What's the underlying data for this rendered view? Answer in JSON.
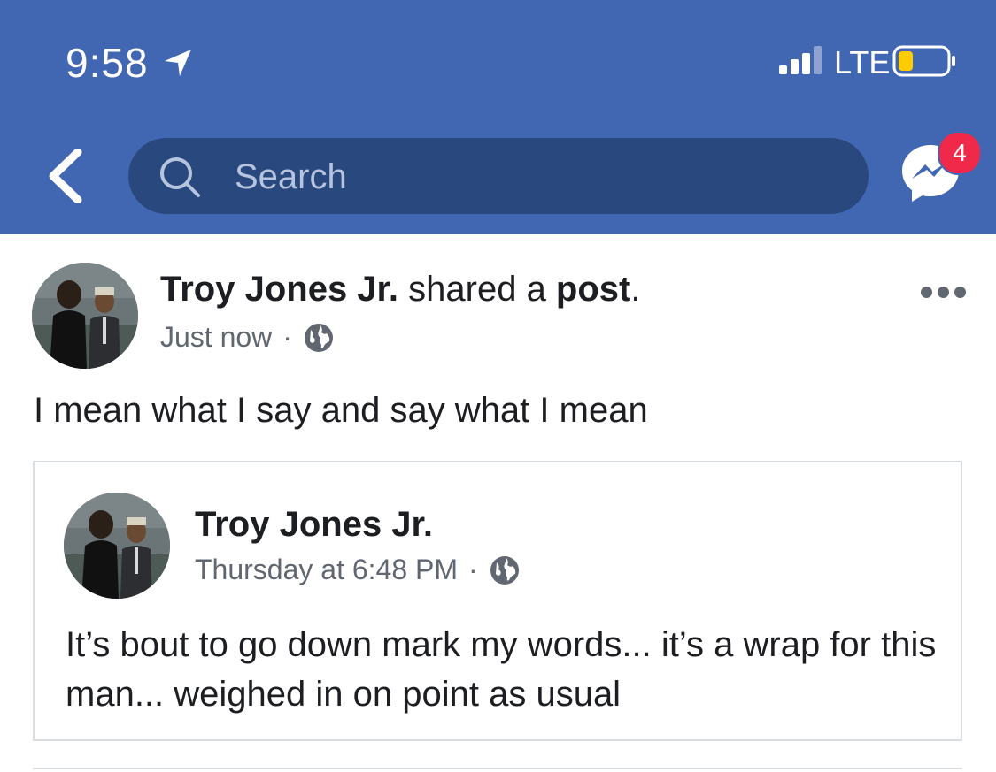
{
  "status_bar": {
    "time": "9:58",
    "network": "LTE",
    "location_icon": "location-arrow-icon",
    "signal_icon": "cellular-signal-icon",
    "battery_icon": "battery-low-icon"
  },
  "nav": {
    "back_icon": "chevron-left-icon",
    "search_placeholder": "Search",
    "messenger_icon": "messenger-icon",
    "messenger_badge": "4"
  },
  "post": {
    "author": "Troy Jones Jr.",
    "action_text": " shared a ",
    "object_text": "post",
    "period": ".",
    "timestamp": "Just now",
    "separator": "·",
    "privacy_icon": "globe-icon",
    "more_icon": "more-options-icon",
    "text": "I mean what I say and say what I mean"
  },
  "shared_post": {
    "author": "Troy Jones Jr.",
    "timestamp": "Thursday at 6:48 PM",
    "separator": "·",
    "privacy_icon": "globe-icon",
    "text": "It’s bout to go down mark my words... it’s a wrap for this man... weighed in on point as usual"
  },
  "colors": {
    "brand_blue": "#4267b2",
    "search_bg": "#29487d",
    "badge_red": "#f02849",
    "meta_gray": "#606770",
    "battery_yellow": "#ffcc00"
  }
}
